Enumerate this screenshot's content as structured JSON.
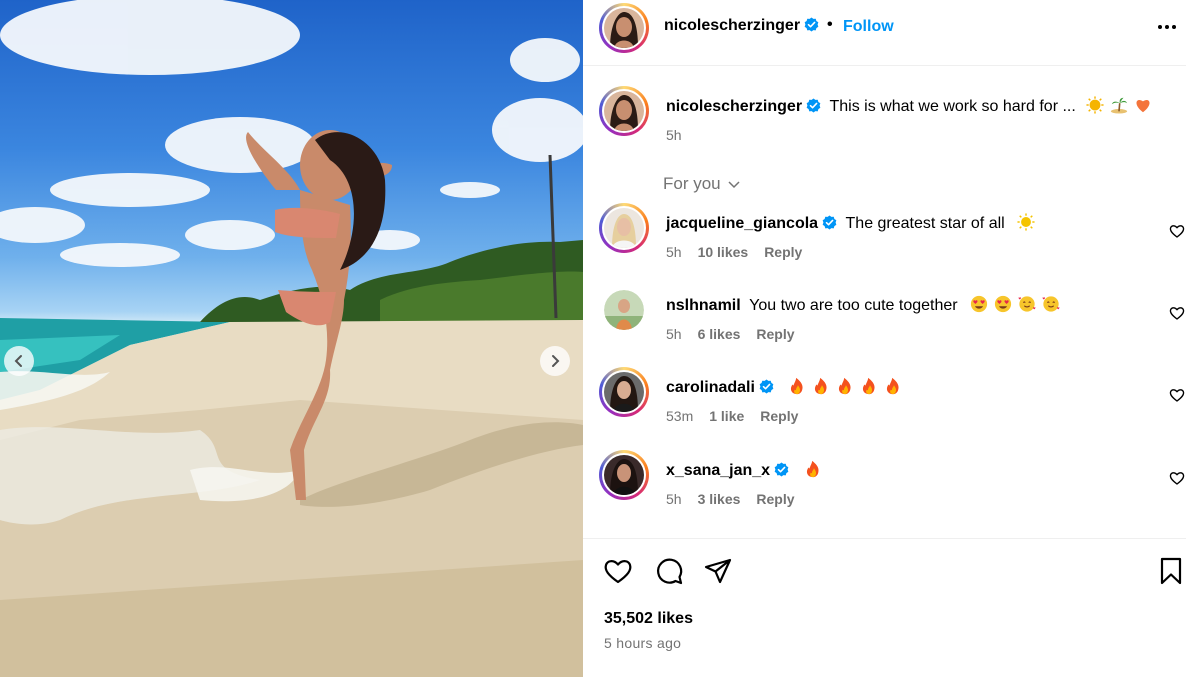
{
  "post": {
    "author": "nicolescherzinger",
    "follow_label": "Follow",
    "separator": "•",
    "more_icon": "more-horizontal-icon",
    "media": {
      "prev_icon": "chevron-left-icon",
      "next_icon": "chevron-right-icon"
    }
  },
  "caption": {
    "author": "nicolescherzinger",
    "text": "This is what we work so hard for ... ",
    "emojis": [
      "sun-emoji",
      "palm-island-emoji",
      "orange-heart-emoji"
    ],
    "time": "5h"
  },
  "comments_filter": {
    "label": "For you"
  },
  "comments": [
    {
      "user": "jacqueline_giancola",
      "verified": true,
      "text": "The greatest star of all",
      "emojis": [
        "sun-emoji"
      ],
      "time": "5h",
      "likes": "10 likes",
      "reply": "Reply"
    },
    {
      "user": "nslhnamil",
      "verified": false,
      "text": "You two are too cute together",
      "emojis": [
        "heart-eyes-emoji",
        "heart-eyes-emoji",
        "smiling-hearts-emoji",
        "smiling-hearts-emoji"
      ],
      "time": "5h",
      "likes": "6 likes",
      "reply": "Reply"
    },
    {
      "user": "carolinadali",
      "verified": true,
      "text": "",
      "emojis": [
        "fire-emoji",
        "fire-emoji",
        "fire-emoji",
        "fire-emoji",
        "fire-emoji"
      ],
      "time": "53m",
      "likes": "1 like",
      "reply": "Reply"
    },
    {
      "user": "x_sana_jan_x",
      "verified": true,
      "text": "",
      "emojis": [
        "fire-emoji"
      ],
      "time": "5h",
      "likes": "3 likes",
      "reply": "Reply"
    }
  ],
  "actions": {
    "like_icon": "heart-icon",
    "comment_icon": "comment-icon",
    "share_icon": "paper-plane-icon",
    "save_icon": "bookmark-icon",
    "likes_count": "35,502 likes",
    "posted": "5 hours ago"
  },
  "colors": {
    "link": "#0095f6",
    "muted": "#737373",
    "verified": "#0095f6"
  }
}
